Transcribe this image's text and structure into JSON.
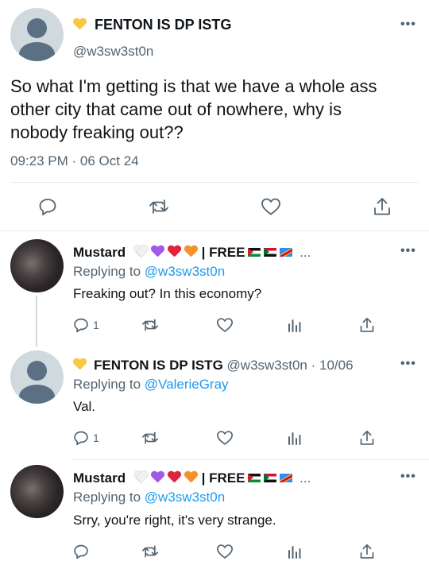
{
  "main_tweet": {
    "display_name": "FENTON IS DP ISTG",
    "name_emoji": "yellow-heart",
    "handle": "@w3sw3st0n",
    "text_line1": "So what I'm getting is that we have a whole ass",
    "text_line2": "other city that came out of nowhere, why is",
    "text_line3": "nobody freaking out??",
    "time": "09:23 PM",
    "separator": "·",
    "date": "06 Oct 24",
    "more": "•••"
  },
  "replies": [
    {
      "display_name": "Mustard",
      "name_emojis": [
        "white-heart",
        "purple-heart",
        "red-heart",
        "orange-heart"
      ],
      "name_suffix": "| FREE",
      "name_flags": [
        "palestine-flag",
        "sudan-flag",
        "congo-flag"
      ],
      "ellipsis": "...",
      "replying_to_label": "Replying to",
      "replying_to": "@w3sw3st0n",
      "text": "Freaking out? In this economy?",
      "reply_count": "1",
      "more": "•••"
    },
    {
      "display_name": "FENTON IS DP ISTG",
      "name_emoji": "yellow-heart",
      "handle_date": "@w3sw3st0n · 10/06",
      "replying_to_label": "Replying to",
      "replying_to": "@ValerieGray",
      "text": "Val.",
      "reply_count": "1",
      "more": "•••"
    },
    {
      "display_name": "Mustard",
      "name_emojis": [
        "white-heart",
        "purple-heart",
        "red-heart",
        "orange-heart"
      ],
      "name_suffix": "| FREE",
      "name_flags": [
        "palestine-flag",
        "sudan-flag",
        "congo-flag"
      ],
      "ellipsis": "...",
      "replying_to_label": "Replying to",
      "replying_to": "@w3sw3st0n",
      "text": "Srry, you're right, it's very strange.",
      "more": "•••"
    }
  ],
  "colors": {
    "text": "#0f1419",
    "muted": "#536471",
    "link": "#1d9bf0",
    "divider": "#e6ecf0",
    "avatar_bg": "#cfd9de",
    "avatar_fg": "#5b7083"
  },
  "icons": [
    "reply-icon",
    "retweet-icon",
    "like-icon",
    "share-icon",
    "analytics-icon",
    "more-icon"
  ]
}
